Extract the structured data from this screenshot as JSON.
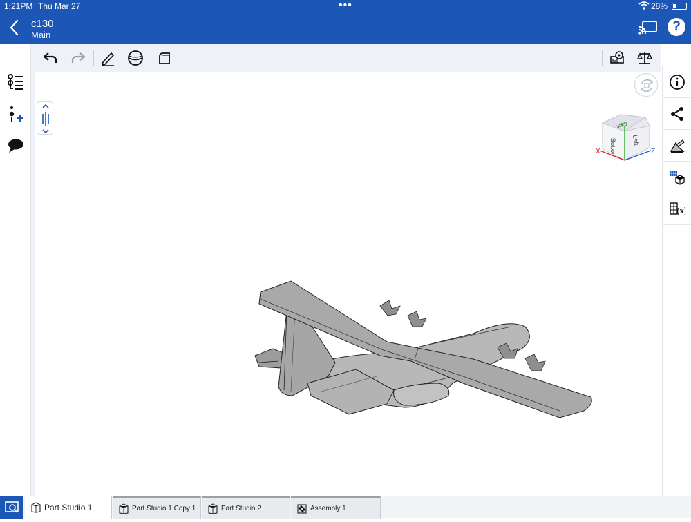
{
  "status_bar": {
    "time": "1:21PM",
    "date": "Thu Mar 27",
    "dots": "•••",
    "battery": "28%"
  },
  "header": {
    "title": "c130",
    "subtitle": "Main",
    "back_icon": "chevron-left-icon",
    "cast_icon": "cast-icon",
    "help_label": "?"
  },
  "left_rail": {
    "icons": [
      "feature-list-icon",
      "add-part-icon",
      "comment-icon"
    ]
  },
  "toolbar": {
    "icons": [
      "undo-icon",
      "redo-icon",
      "sketch-icon",
      "extrude-sphere-icon",
      "fillet-icon",
      "measure-tape-icon",
      "mass-properties-icon"
    ]
  },
  "view_cube": {
    "faces": [
      "Bottom",
      "Left",
      "Back"
    ],
    "axes": [
      "X",
      "Y",
      "Z"
    ]
  },
  "right_rail": {
    "icons": [
      "info-icon",
      "share-icon",
      "appearance-icon",
      "parts-icon",
      "variables-icon"
    ]
  },
  "tabs": [
    {
      "label": "Part Studio 1",
      "active": true,
      "icon": "part-studio-icon"
    },
    {
      "label": "Part Studio 1 Copy 1",
      "active": false,
      "icon": "part-studio-icon"
    },
    {
      "label": "Part Studio 2",
      "active": false,
      "icon": "part-studio-icon"
    },
    {
      "label": "Assembly 1",
      "active": false,
      "icon": "assembly-icon"
    }
  ],
  "colors": {
    "brand": "#1d57b6",
    "toolbar_bg": "#eef2f8",
    "model_gray": "#a9a9a9"
  }
}
